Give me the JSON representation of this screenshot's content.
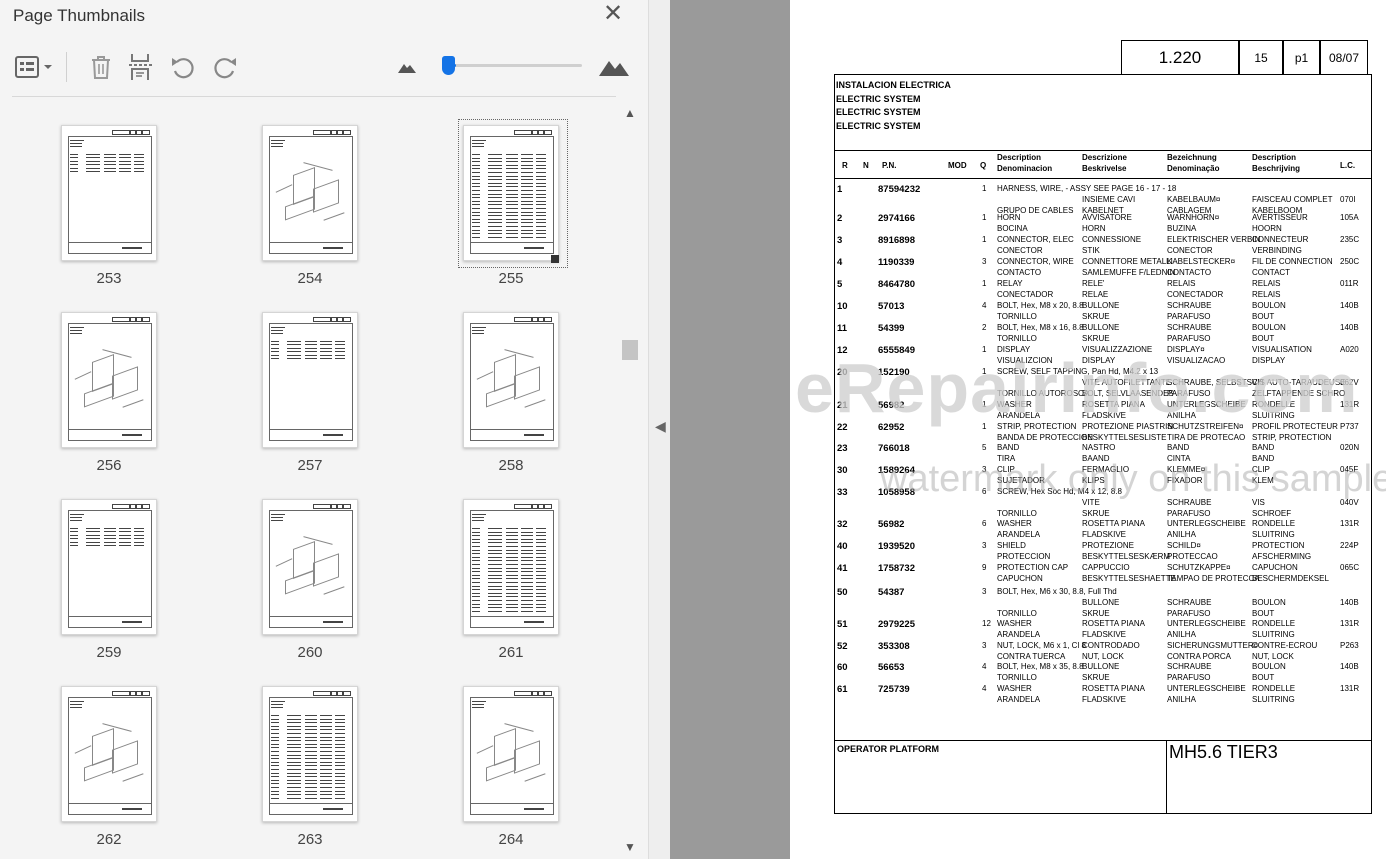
{
  "panel": {
    "title": "Page Thumbnails",
    "close_icon": "close-icon",
    "toolbar": {
      "options_icon": "thumbnail-options-icon",
      "delete_icon": "trash-icon",
      "insert_icon": "insert-pages-icon",
      "rotate_ccw_icon": "rotate-counterclockwise-icon",
      "rotate_cw_icon": "rotate-clockwise-icon",
      "zoom_out_icon": "small-mountain-icon",
      "zoom_in_icon": "large-mountain-icon",
      "zoom_slider_value": 0.06
    },
    "thumbnails": [
      {
        "page": "253",
        "kind": "list"
      },
      {
        "page": "254",
        "kind": "drawing"
      },
      {
        "page": "255",
        "kind": "dense",
        "selected": true
      },
      {
        "page": "256",
        "kind": "drawing"
      },
      {
        "page": "257",
        "kind": "list"
      },
      {
        "page": "258",
        "kind": "drawing"
      },
      {
        "page": "259",
        "kind": "list"
      },
      {
        "page": "260",
        "kind": "drawing"
      },
      {
        "page": "261",
        "kind": "dense"
      },
      {
        "page": "262",
        "kind": "drawing"
      },
      {
        "page": "263",
        "kind": "dense"
      },
      {
        "page": "264",
        "kind": "drawing"
      }
    ]
  },
  "document": {
    "ref_code": "1.220",
    "ref_page": "15",
    "ref_p": "p1",
    "ref_date": "08/07",
    "titles": [
      "INSTALACION ELECTRICA",
      "ELECTRIC SYSTEM",
      "ELECTRIC SYSTEM",
      "ELECTRIC SYSTEM"
    ],
    "columns": {
      "r": "R",
      "n": "N",
      "pn": "P.N.",
      "mod": "MOD",
      "q": "Q",
      "c1a": "Description",
      "c1b": "Denominacion",
      "c2a": "Descrizione",
      "c2b": "Beskrivelse",
      "c3a": "Bezeichnung",
      "c3b": "Denominação",
      "c4a": "Description",
      "c4b": "Beschrijving",
      "lc": "L.C."
    },
    "rows": [
      {
        "r": "1",
        "pn": "87594232",
        "q": "1",
        "l1": [
          "HARNESS, WIRE, - ASSY SEE PAGE 16 - 17 - 18",
          "",
          "",
          "",
          ""
        ],
        "l2": [
          "",
          "INSIEME CAVI",
          "KABELBAUM¤",
          "FAISCEAU COMPLET",
          "070I"
        ],
        "l3": [
          "GRUPO DE CABLES",
          "KABELNET",
          "CABLAGEM",
          "KABELBOOM",
          ""
        ]
      },
      {
        "r": "2",
        "pn": "2974166",
        "q": "1",
        "l1": [
          "HORN",
          "AVVISATORE",
          "WARNHORN¤",
          "AVERTISSEUR",
          "105A"
        ],
        "l2": [
          "BOCINA",
          "HORN",
          "BUZINA",
          "HOORN",
          ""
        ]
      },
      {
        "r": "3",
        "pn": "8916898",
        "q": "1",
        "l1": [
          "CONNECTOR, ELEC",
          "CONNESSIONE",
          "ELEKTRISCHER VERBIN",
          "CONNECTEUR",
          "235C"
        ],
        "l2": [
          "CONECTOR",
          "STIK",
          "CONECTOR",
          "VERBINDING",
          ""
        ]
      },
      {
        "r": "4",
        "pn": "1190339",
        "q": "3",
        "l1": [
          "CONNECTOR, WIRE",
          "CONNETTORE METALLI",
          "KABELSTECKER¤",
          "FIL DE CONNECTION",
          "250C"
        ],
        "l2": [
          "CONTACTO",
          "SAMLEMUFFE F/LEDNIN",
          "CONTACTO",
          "CONTACT",
          ""
        ]
      },
      {
        "r": "5",
        "pn": "8464780",
        "q": "1",
        "l1": [
          "RELAY",
          "RELE'",
          "RELAIS",
          "RELAIS",
          "011R"
        ],
        "l2": [
          "CONECTADOR",
          "RELAE",
          "CONECTADOR",
          "RELAIS",
          ""
        ]
      },
      {
        "r": "10",
        "pn": "57013",
        "q": "4",
        "l1": [
          "BOLT, Hex, M8 x 20, 8.8",
          "BULLONE",
          "SCHRAUBE",
          "BOULON",
          "140B"
        ],
        "l2": [
          "TORNILLO",
          "SKRUE",
          "PARAFUSO",
          "BOUT",
          ""
        ]
      },
      {
        "r": "11",
        "pn": "54399",
        "q": "2",
        "l1": [
          "BOLT, Hex, M8 x 16, 8.8",
          "BULLONE",
          "SCHRAUBE",
          "BOULON",
          "140B"
        ],
        "l2": [
          "TORNILLO",
          "SKRUE",
          "PARAFUSO",
          "BOUT",
          ""
        ]
      },
      {
        "r": "12",
        "pn": "6555849",
        "q": "1",
        "l1": [
          "DISPLAY",
          "VISUALIZZAZIONE",
          "DISPLAY¤",
          "VISUALISATION",
          "A020"
        ],
        "l2": [
          "VISUALIZCION",
          "DISPLAY",
          "VISUALIZACAO",
          "DISPLAY",
          ""
        ]
      },
      {
        "r": "20",
        "pn": "152190",
        "q": "1",
        "l1": [
          "SCREW, SELF TAPPING, Pan Hd, M4.2 x 13",
          "",
          "",
          "",
          ""
        ],
        "l2": [
          "",
          "VITE AUTOFILETTANTE",
          "SCHRAUBE, SELBSTSCH",
          "VIS AUTO-TARAUDEUSE",
          "062V"
        ],
        "l3": [
          "TORNILLO AUTOROSCA",
          "BOLT, SELVLAASENDES",
          "PARAFUSO",
          "ZELFTAPPENDE SCHRO",
          ""
        ]
      },
      {
        "r": "21",
        "pn": "56982",
        "q": "1",
        "l1": [
          "WASHER",
          "ROSETTA PIANA",
          "UNTERLEGSCHEIBE",
          "RONDELLE",
          "131R"
        ],
        "l2": [
          "ARANDELA",
          "FLADSKIVE",
          "ANILHA",
          "SLUITRING",
          ""
        ]
      },
      {
        "r": "22",
        "pn": "62952",
        "q": "1",
        "l1": [
          "STRIP, PROTECTION",
          "PROTEZIONE PIASTRIN",
          "SCHUTZSTREIFEN¤",
          "PROFIL PROTECTEUR",
          "P737"
        ],
        "l2": [
          "BANDA DE PROTECCION",
          "BESKYTTELSESLISTE",
          "TIRA DE PROTECAO",
          "STRIP, PROTECTION",
          ""
        ]
      },
      {
        "r": "23",
        "pn": "766018",
        "q": "5",
        "l1": [
          "BAND",
          "NASTRO",
          "BAND",
          "BAND",
          "020N"
        ],
        "l2": [
          "TIRA",
          "BAAND",
          "CINTA",
          "BAND",
          ""
        ]
      },
      {
        "r": "30",
        "pn": "1589264",
        "q": "3",
        "l1": [
          "CLIP",
          "FERMAGLIO",
          "KLEMME¤",
          "CLIP",
          "045F"
        ],
        "l2": [
          "SUJETADOR",
          "KLIPS",
          "FIXADOR",
          "KLEM",
          ""
        ]
      },
      {
        "r": "33",
        "pn": "1058958",
        "q": "6",
        "l1": [
          "SCREW, Hex Soc Hd, M4 x 12, 8.8",
          "",
          "",
          "",
          ""
        ],
        "l2": [
          "",
          "VITE",
          "SCHRAUBE",
          "VIS",
          "040V"
        ],
        "l3": [
          "TORNILLO",
          "SKRUE",
          "PARAFUSO",
          "SCHROEF",
          ""
        ]
      },
      {
        "r": "32",
        "pn": "56982",
        "q": "6",
        "l1": [
          "WASHER",
          "ROSETTA PIANA",
          "UNTERLEGSCHEIBE",
          "RONDELLE",
          "131R"
        ],
        "l2": [
          "ARANDELA",
          "FLADSKIVE",
          "ANILHA",
          "SLUITRING",
          ""
        ]
      },
      {
        "r": "40",
        "pn": "1939520",
        "q": "3",
        "l1": [
          "SHIELD",
          "PROTEZIONE",
          "SCHILD¤",
          "PROTECTION",
          "224P"
        ],
        "l2": [
          "PROTECCION",
          "BESKYTTELSESKÆRM",
          "PROTECCAO",
          "AFSCHERMING",
          ""
        ]
      },
      {
        "r": "41",
        "pn": "1758732",
        "q": "9",
        "l1": [
          "PROTECTION CAP",
          "CAPPUCCIO",
          "SCHUTZKAPPE¤",
          "CAPUCHON",
          "065C"
        ],
        "l2": [
          "CAPUCHON",
          "BESKYTTELSESHAETTE",
          "TAMPAO DE PROTECCA",
          "BESCHERMDEKSEL",
          ""
        ]
      },
      {
        "r": "50",
        "pn": "54387",
        "q": "3",
        "l1": [
          "BOLT, Hex, M6 x 30, 8.8, Full Thd",
          "",
          "",
          "",
          ""
        ],
        "l2": [
          "",
          "BULLONE",
          "SCHRAUBE",
          "BOULON",
          "140B"
        ],
        "l3": [
          "TORNILLO",
          "SKRUE",
          "PARAFUSO",
          "BOUT",
          ""
        ]
      },
      {
        "r": "51",
        "pn": "2979225",
        "q": "12",
        "l1": [
          "WASHER",
          "ROSETTA PIANA",
          "UNTERLEGSCHEIBE",
          "RONDELLE",
          "131R"
        ],
        "l2": [
          "ARANDELA",
          "FLADSKIVE",
          "ANILHA",
          "SLUITRING",
          ""
        ]
      },
      {
        "r": "52",
        "pn": "353308",
        "q": "3",
        "l1": [
          "NUT, LOCK, M6 x 1, Cl 8",
          "CONTRODADO",
          "SICHERUNGSMUTTER¤",
          "CONTRE-ECROU",
          "P263"
        ],
        "l2": [
          "CONTRA TUERCA",
          "NUT, LOCK",
          "CONTRA PORCA",
          "NUT, LOCK",
          ""
        ]
      },
      {
        "r": "60",
        "pn": "56653",
        "q": "4",
        "l1": [
          "BOLT, Hex, M8 x 35, 8.8",
          "BULLONE",
          "SCHRAUBE",
          "BOULON",
          "140B"
        ],
        "l2": [
          "TORNILLO",
          "SKRUE",
          "PARAFUSO",
          "BOUT",
          ""
        ]
      },
      {
        "r": "61",
        "pn": "725739",
        "q": "4",
        "l1": [
          "WASHER",
          "ROSETTA PIANA",
          "UNTERLEGSCHEIBE",
          "RONDELLE",
          "131R"
        ],
        "l2": [
          "ARANDELA",
          "FLADSKIVE",
          "ANILHA",
          "SLUITRING",
          ""
        ]
      }
    ],
    "footer_left": "OPERATOR PLATFORM",
    "footer_right": "MH5.6 TIER3"
  },
  "watermark": {
    "line1": "eRepairinfo.com",
    "line2": "watermark only on this sample"
  }
}
